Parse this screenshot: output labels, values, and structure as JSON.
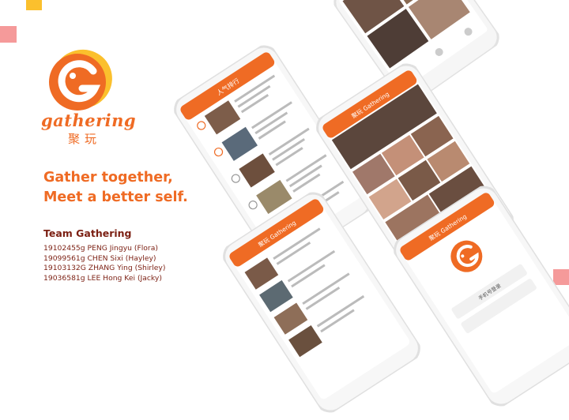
{
  "brand": {
    "name": "gathering",
    "name_cn": "聚玩",
    "primary_color": "#ef6b24",
    "accent_color": "#fbc02d",
    "text_color": "#7b1f12"
  },
  "tagline": {
    "line1": "Gather together,",
    "line2": "Meet a better self."
  },
  "team": {
    "title": "Team Gathering",
    "members": [
      "19102455g PENG Jingyu (Flora)",
      "19099561g CHEN Sixi (Hayley)",
      "19103132G ZHANG Ying (Shirley)",
      "19036581g LEE Hong Kei (Jacky)"
    ]
  },
  "phones": {
    "ranking_title": "人气排行",
    "home_title": "聚玩 Gathering",
    "login_title": "聚玩 Gathering",
    "login_field": "手机号登录",
    "list_title": "聚玩 Gathering"
  }
}
